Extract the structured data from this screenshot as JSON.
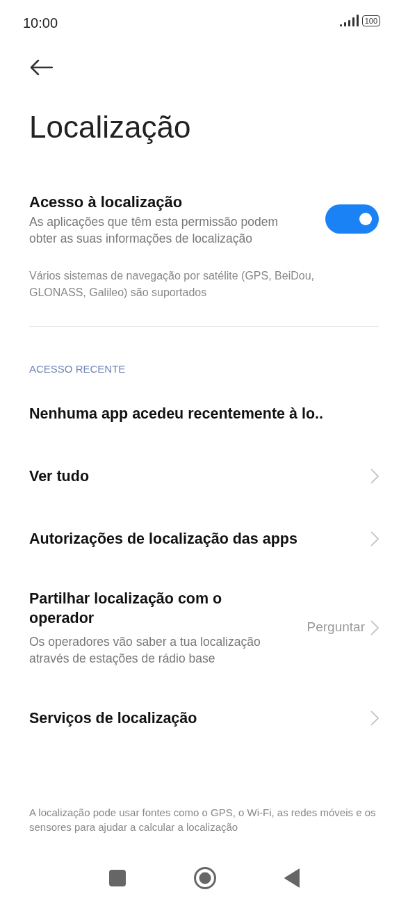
{
  "status_bar": {
    "time": "10:00",
    "battery": "100"
  },
  "title": "Localização",
  "location_access": {
    "title": "Acesso à localização",
    "description": "As aplicações que têm esta permissão podem obter as suas informações de localização",
    "on": true
  },
  "note": "Vários sistemas de navegação por satélite (GPS, BeiDou, GLONASS, Galileo) são suportados",
  "section_header": "ACESSO RECENTE",
  "items": [
    {
      "kind": "text",
      "title": "Nenhuma app acedeu recentemente à lo.."
    },
    {
      "kind": "link",
      "title": "Ver tudo"
    },
    {
      "kind": "link",
      "title": "Autorizações de localização das apps"
    },
    {
      "kind": "link",
      "title": "Partilhar localização com o operador",
      "description": "Os operadores vão saber a tua localização através de estações de rádio base",
      "value": "Perguntar"
    },
    {
      "kind": "link",
      "title": "Serviços de localização"
    }
  ],
  "footer": "A localização pode usar fontes como o GPS, o Wi-Fi, as redes móveis e os sensores para ajudar a calcular a localização"
}
